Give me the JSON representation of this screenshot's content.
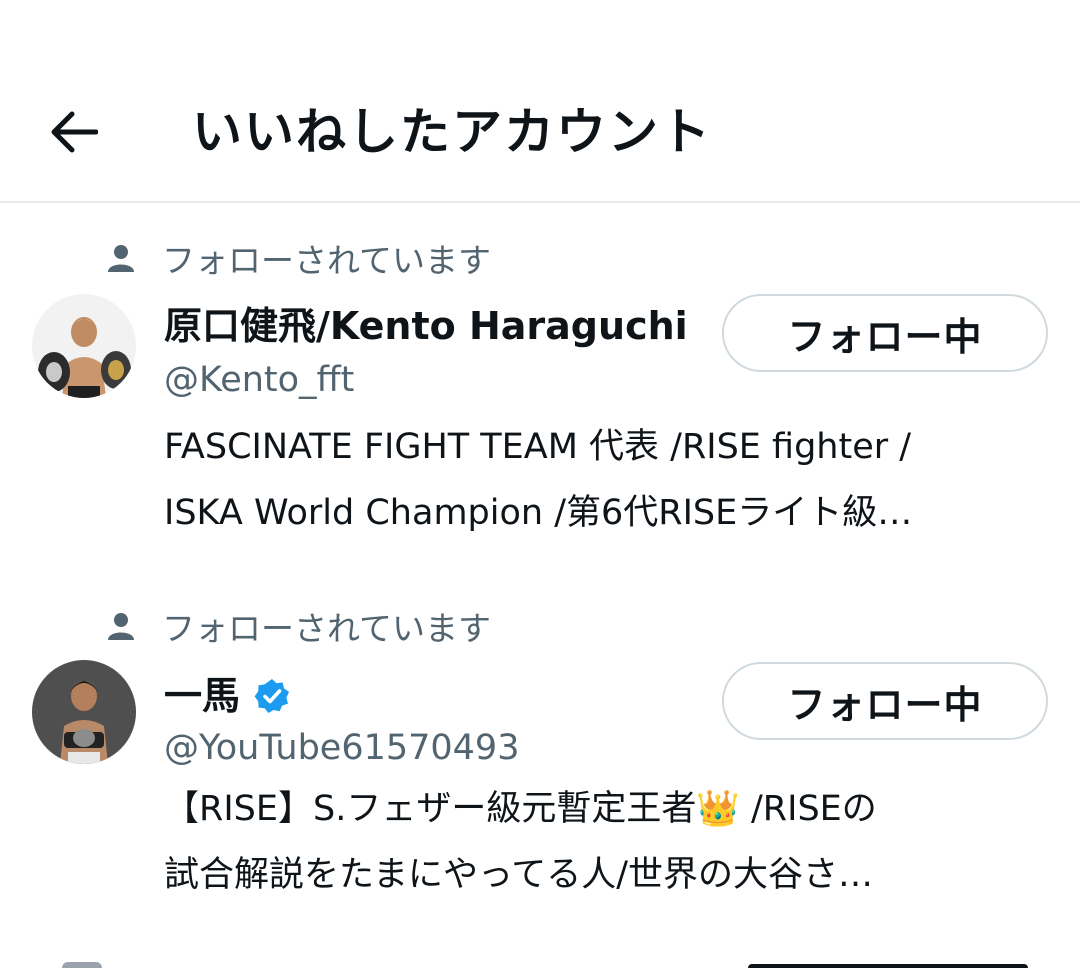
{
  "header": {
    "title": "いいねしたアカウント",
    "back_icon": "arrow-left-icon"
  },
  "users": [
    {
      "social_context": "フォローされています",
      "display_name": "原口健飛/Kento Haraguchi",
      "verified": false,
      "handle": "@Kento_fft",
      "bio_line_1": "FASCINATE FIGHT TEAM 代表 /RISE fighter /",
      "bio_line_2": "ISKA World Champion /第6代RISEライト級…",
      "follow_label": "フォロー中"
    },
    {
      "social_context": "フォローされています",
      "display_name": "一馬",
      "verified": true,
      "handle": "@YouTube61570493",
      "bio_line_1": "【RISE】S.フェザー級元暫定王者👑 /RISEの",
      "bio_line_2": "試合解説をたまにやってる人/世界の大谷さ…",
      "follow_label": "フォロー中"
    }
  ],
  "colors": {
    "text_primary": "#0f1419",
    "text_secondary": "#536471",
    "border": "#cfd9de",
    "divider": "#e7e9ea",
    "verified_blue": "#1d9bf0"
  }
}
